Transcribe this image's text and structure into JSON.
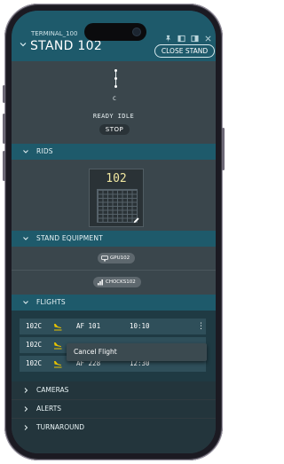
{
  "header": {
    "terminal": "TERMINAL_100",
    "title": "STAND 102",
    "close_button": "CLOSE STAND"
  },
  "status": {
    "chain_label": "C",
    "state": "READY IDLE",
    "stop_button": "STOP"
  },
  "sections": {
    "rids": "RIDS",
    "stand_equipment": "STAND EQUIPMENT",
    "flights": "FLIGHTS",
    "cameras": "CAMERAS",
    "alerts": "ALERTS",
    "turnaround": "TURNAROUND"
  },
  "rids": {
    "stand_number": "102"
  },
  "equipment": [
    {
      "label": "GPU102",
      "icon": "gpu-icon"
    },
    {
      "label": "CHOCKS102",
      "icon": "chocks-icon"
    }
  ],
  "flights": [
    {
      "stand": "102C",
      "flight": "AF 101",
      "time": "10:10"
    },
    {
      "stand": "102C",
      "flight": "",
      "time": ""
    },
    {
      "stand": "102C",
      "flight": "AF 228",
      "time": "12:30"
    }
  ],
  "flight_menu": {
    "cancel": "Cancel Flight"
  },
  "colors": {
    "header_teal": "#1e5a6b",
    "body_slate": "#3a464c",
    "rids_number": "#f0e7a0",
    "arrival_icon": "#e8c300"
  }
}
